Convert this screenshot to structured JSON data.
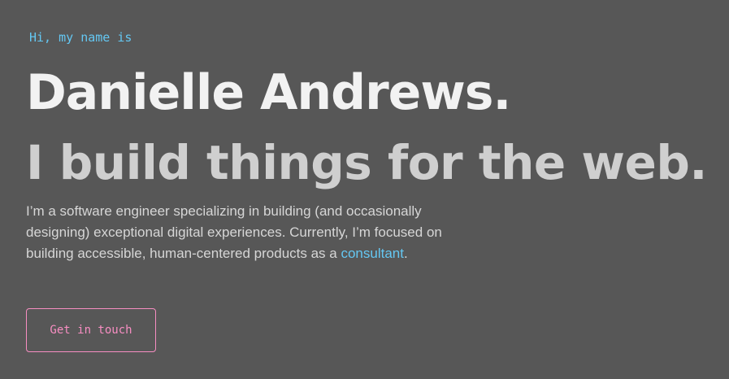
{
  "hero": {
    "greeting": "Hi, my name is",
    "name": "Danielle Andrews.",
    "tagline": "I build things for the web.",
    "intro_text": "I’m a software engineer specializing in building (and occasionally designing) exceptional digital experiences. Currently, I’m focused on building accessible, human-centered products as a ",
    "intro_link": "consultant",
    "intro_end": ".",
    "cta_label": "Get in touch"
  },
  "colors": {
    "background": "#575757",
    "accent_blue": "#64c7f2",
    "accent_pink": "#f78ec2",
    "heading": "#f2f2f2",
    "subheading": "#cfcfcf",
    "body_text": "#d6d6d6"
  }
}
